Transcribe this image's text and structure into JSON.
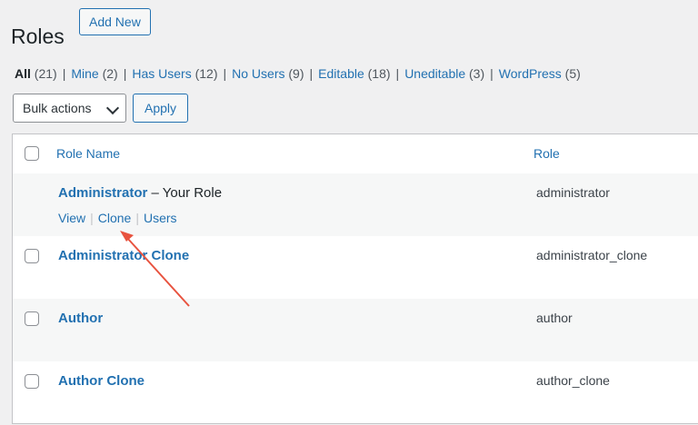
{
  "header": {
    "title": "Roles",
    "add_new_label": "Add New"
  },
  "filters": [
    {
      "label": "All",
      "count": "(21)",
      "current": true
    },
    {
      "label": "Mine",
      "count": "(2)"
    },
    {
      "label": "Has Users",
      "count": "(12)"
    },
    {
      "label": "No Users",
      "count": "(9)"
    },
    {
      "label": "Editable",
      "count": "(18)"
    },
    {
      "label": "Uneditable",
      "count": "(3)"
    },
    {
      "label": "WordPress",
      "count": "(5)"
    }
  ],
  "toolbar": {
    "bulk_actions_label": "Bulk actions",
    "apply_label": "Apply"
  },
  "table": {
    "columns": {
      "role_name": "Role Name",
      "role": "Role"
    },
    "rows": [
      {
        "name": "Administrator",
        "suffix": " – Your Role",
        "slug": "administrator",
        "actions": [
          "View",
          "Clone",
          "Users"
        ]
      },
      {
        "name": "Administrator Clone",
        "slug": "administrator_clone"
      },
      {
        "name": "Author",
        "slug": "author"
      },
      {
        "name": "Author Clone",
        "slug": "author_clone"
      }
    ]
  },
  "colors": {
    "link": "#2271b1",
    "annotation_arrow": "#e8533f"
  }
}
